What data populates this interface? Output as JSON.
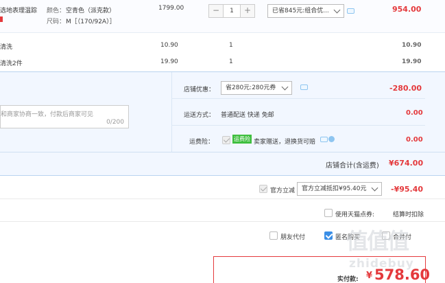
{
  "item_main": {
    "name": "选地表理温踪",
    "color_label": "颜色：",
    "color_value": "空青色（派克款）",
    "size_label": "尺码：",
    "size_value": "M［（170/92A）］",
    "unit_price": "1799.00",
    "quantity": "1",
    "promo_select": "已省845元:组合优...",
    "subtotal": "954.00"
  },
  "services": [
    {
      "name": "清洗",
      "price": "10.90",
      "qty": "1",
      "subtotal": "10.90"
    },
    {
      "name": "清洗2件",
      "price": "19.90",
      "qty": "1",
      "subtotal": "19.90"
    }
  ],
  "shop": {
    "discount_label": "店铺优惠：",
    "discount_select": "省280元:280元券",
    "discount_amount": "-280.00",
    "message_placeholder": "和商家协商一致，付款后商家可见",
    "message_count": "0/200",
    "shipping_label": "运送方式：",
    "shipping_value": "普通配送 快递 免邮",
    "shipping_amount": "0.00",
    "insurance_label": "运费险：",
    "insurance_tag": "运费险",
    "insurance_text": "卖家赠送，退换货可赔",
    "insurance_amount": "0.00",
    "total_label": "店铺合计(含运费)",
    "total_amount": "¥674.00"
  },
  "platform": {
    "official_label": "官方立减",
    "official_select": "官方立减抵扣¥95.40元",
    "official_amount": "-¥95.40",
    "points_label": "使用天猫点券:",
    "points_note": "结算时扣除",
    "friend_pay_label": "朋友代付",
    "anonymous_label": "匿名购买",
    "merge_label": "合并付"
  },
  "payment": {
    "label": "实付款:",
    "currency": "¥",
    "amount": "578.60"
  },
  "watermark": {
    "logo": "值值值",
    "site": "zhidebuy"
  },
  "colors": {
    "accent_red": "#e4393c",
    "row_bg": "#f2f7ff",
    "border_blue": "#b9d3f0"
  }
}
